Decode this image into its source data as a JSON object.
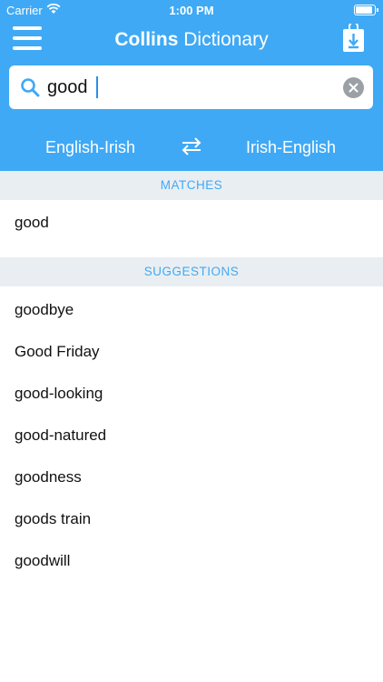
{
  "status_bar": {
    "carrier": "Carrier",
    "time": "1:00 PM"
  },
  "header": {
    "title_bold": "Collins",
    "title_rest": " Dictionary",
    "background_color": "#3fa9f5"
  },
  "search": {
    "value": "good",
    "placeholder": ""
  },
  "languages": {
    "left": "English-Irish",
    "right": "Irish-English"
  },
  "matches": {
    "title": "MATCHES",
    "items": [
      "good"
    ]
  },
  "suggestions": {
    "title": "SUGGESTIONS",
    "items": [
      "goodbye",
      "Good Friday",
      "good-looking",
      "good-natured",
      "goodness",
      "goods train",
      "goodwill"
    ]
  },
  "icons": {
    "menu": "hamburger-menu-icon",
    "download": "download-icon",
    "search": "search-icon",
    "clear": "clear-icon",
    "swap": "swap-arrows-icon",
    "wifi": "wifi-icon",
    "battery": "battery-icon"
  }
}
